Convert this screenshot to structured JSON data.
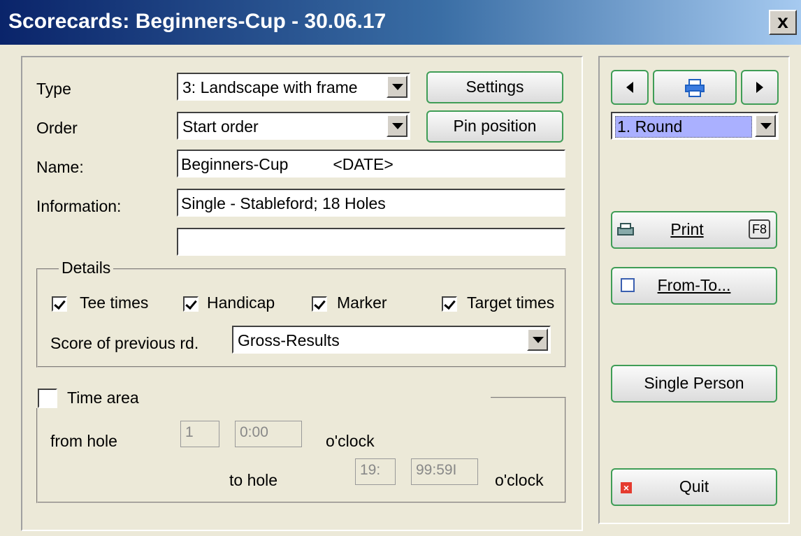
{
  "window": {
    "title": "Scorecards: Beginners-Cup - 30.06.17",
    "close_label": "x"
  },
  "form": {
    "type_label": "Type",
    "type_value": "3: Landscape with frame",
    "settings_label": "Settings",
    "order_label": "Order",
    "order_value": "Start order",
    "pin_position_label": "Pin position",
    "name_label": "Name:",
    "name_value": "Beginners-Cup          <DATE>",
    "information_label": "Information:",
    "information_value": "Single - Stableford; 18 Holes",
    "information2_value": ""
  },
  "details": {
    "legend": "Details",
    "tee_times": {
      "label": "Tee times",
      "checked": true
    },
    "handicap": {
      "label": "Handicap",
      "checked": true
    },
    "marker": {
      "label": "Marker",
      "checked": true
    },
    "target_times": {
      "label": "Target times",
      "checked": true
    },
    "score_prev_label": "Score of previous rd.",
    "score_prev_value": "Gross-Results"
  },
  "time_area": {
    "label": "Time area",
    "checked": false,
    "from_hole_label": "from hole",
    "from_hole_value": "1",
    "from_time_value": "0:00",
    "oclock1": "o'clock",
    "to_hole_label": "to hole",
    "to_hole_value": "19:",
    "to_time_value": "99:59I",
    "oclock2": "o'clock"
  },
  "right": {
    "round_value": "1. Round",
    "print_label": "Print",
    "print_shortcut": "F8",
    "from_to_label": "From-To...",
    "single_person_label": "Single Person",
    "quit_label": "Quit"
  },
  "colors": {
    "accent_green": "#3f9d56",
    "title_dark": "#0a246a"
  }
}
